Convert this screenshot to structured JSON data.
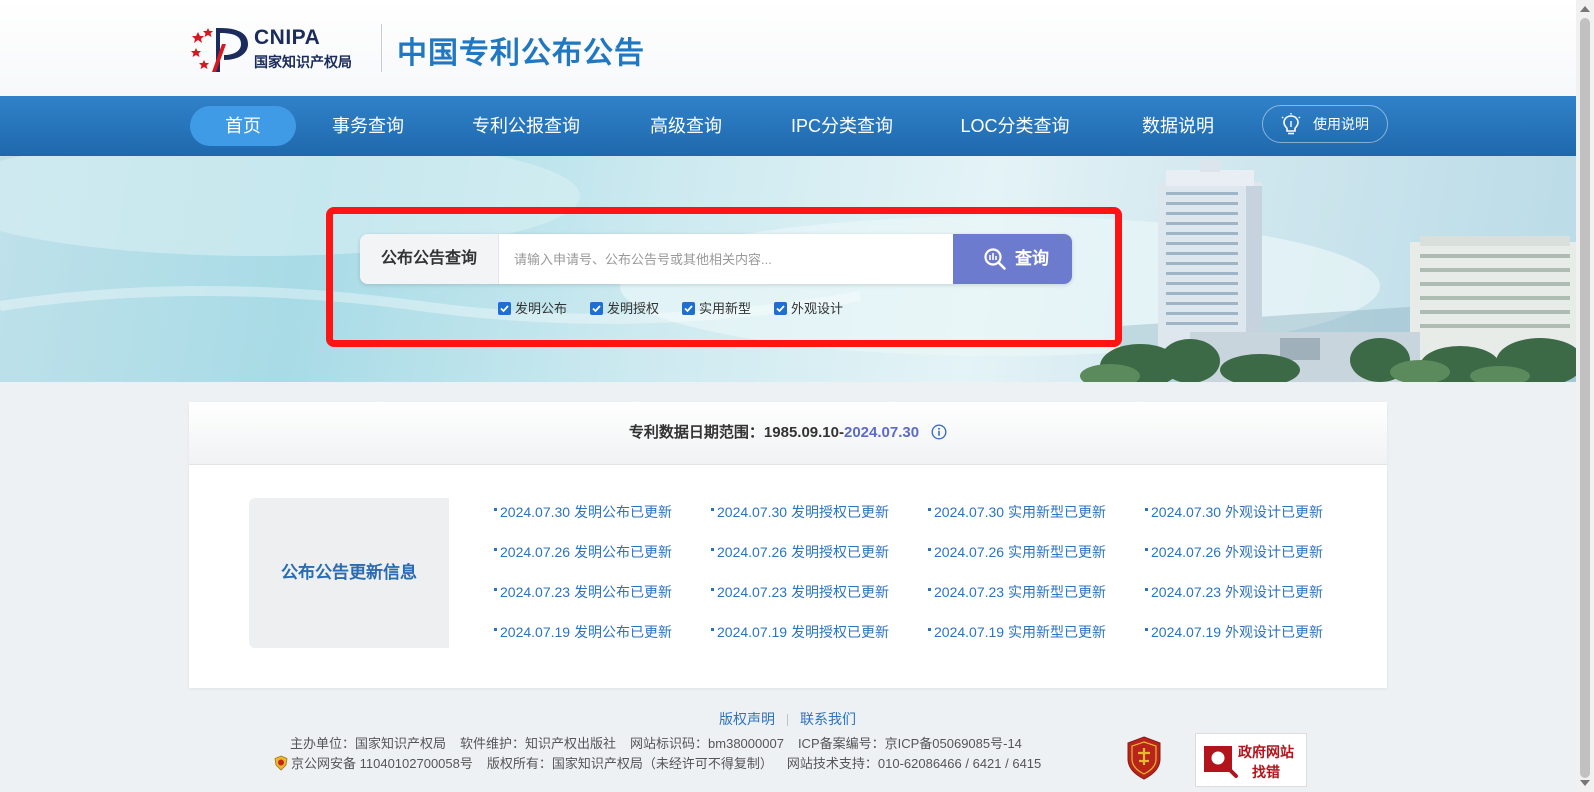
{
  "header": {
    "logo_en": "CNIPA",
    "logo_cn": "国家知识产权局",
    "site_title": "中国专利公布公告"
  },
  "nav": {
    "items": [
      {
        "label": "首页",
        "active": true
      },
      {
        "label": "事务查询"
      },
      {
        "label": "专利公报查询"
      },
      {
        "label": "高级查询"
      },
      {
        "label": "IPC分类查询"
      },
      {
        "label": "LOC分类查询"
      },
      {
        "label": "数据说明"
      }
    ],
    "help_label": "使用说明"
  },
  "search": {
    "label": "公布公告查询",
    "placeholder": "请输入申请号、公布公告号或其他相关内容...",
    "value": "",
    "button_label": "查询",
    "checkboxes": [
      {
        "label": "发明公布",
        "checked": true
      },
      {
        "label": "发明授权",
        "checked": true
      },
      {
        "label": "实用新型",
        "checked": true
      },
      {
        "label": "外观设计",
        "checked": true
      }
    ]
  },
  "range": {
    "prefix": "专利数据日期范围：1985.09.10-",
    "end_date": "2024.07.30"
  },
  "updates": {
    "title": "公布公告更新信息",
    "rows": [
      [
        "2024.07.30 发明公布已更新",
        "2024.07.30 发明授权已更新",
        "2024.07.30 实用新型已更新",
        "2024.07.30 外观设计已更新"
      ],
      [
        "2024.07.26 发明公布已更新",
        "2024.07.26 发明授权已更新",
        "2024.07.26 实用新型已更新",
        "2024.07.26 外观设计已更新"
      ],
      [
        "2024.07.23 发明公布已更新",
        "2024.07.23 发明授权已更新",
        "2024.07.23 实用新型已更新",
        "2024.07.23 外观设计已更新"
      ],
      [
        "2024.07.19 发明公布已更新",
        "2024.07.19 发明授权已更新",
        "2024.07.19 实用新型已更新",
        "2024.07.19 外观设计已更新"
      ]
    ]
  },
  "footer": {
    "copyright_link": "版权声明",
    "contact_link": "联系我们",
    "host": "主办单位：国家知识产权局",
    "maintenance": "软件维护：知识产权出版社",
    "site_id": "网站标识码：bm38000007",
    "icp": "ICP备案编号：京ICP备05069085号-14",
    "police": "京公网安备 11040102700058号",
    "rights": "版权所有：国家知识产权局（未经许可不得复制）",
    "tech_support": "网站技术支持：010-62086466 / 6421 / 6415",
    "gov_line1": "政府网站",
    "gov_line2": "找错"
  },
  "icons": [
    "cnipa-logo",
    "bulb-icon",
    "search-icon",
    "info-icon",
    "police-badge-icon",
    "party-badge-icon",
    "magnifier-icon"
  ],
  "colors": {
    "nav_blue": "#1f68ad",
    "nav_active": "#3f9be6",
    "search_button": "#6d7bcf",
    "highlight_frame": "#ff1414",
    "link_blue": "#2c73c0",
    "range_end": "#5b6bc8"
  }
}
